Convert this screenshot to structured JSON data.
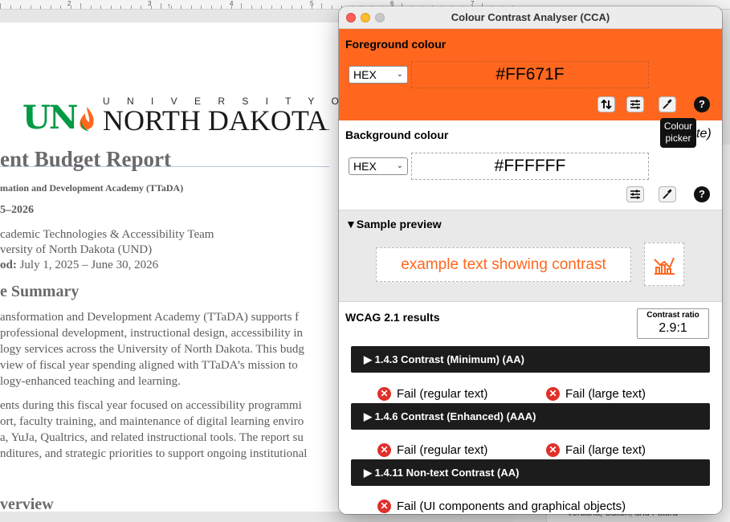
{
  "background_document": {
    "ruler": {
      "numbers": [
        "2",
        "3",
        "4",
        "5",
        "6",
        "7"
      ]
    },
    "logo": {
      "mark": "UND",
      "university_spaced": "U N I V E R S I T Y   O F",
      "name": "NORTH DAKOTA",
      "trademark": "."
    },
    "lines": [
      {
        "text": "ent Budget Report",
        "style": "h1"
      },
      {
        "text": "mation and Development Academy (TTaDA)",
        "style": "sub"
      },
      {
        "text": "5–2026",
        "style": "yr"
      },
      {
        "text": "cademic Technologies & Accessibility Team",
        "style": "p"
      },
      {
        "text": "versity of North Dakota (UND)",
        "style": "p"
      },
      {
        "text_bold": "od:",
        "text": " July 1, 2025 – June 30, 2026",
        "style": "p"
      },
      {
        "text": "e Summary",
        "style": "h2"
      },
      {
        "text": "ansformation and Development Academy (TTaDA) supports f",
        "style": "p"
      },
      {
        "text": " professional development, instructional design, accessibility in",
        "style": "p"
      },
      {
        "text": "logy services across the University of North Dakota. This budg",
        "style": "p"
      },
      {
        "text": "view of fiscal year spending aligned with TTaDA’s mission to",
        "style": "p"
      },
      {
        "text": "logy-enhanced teaching and learning.",
        "style": "p"
      },
      {
        "text": "ents during this fiscal year focused on accessibility programmi",
        "style": "p"
      },
      {
        "text": "ort, faculty training, and maintenance of digital learning enviro",
        "style": "p"
      },
      {
        "text": "a, YuJa, Qualtrics, and related instructional tools. The report su",
        "style": "p"
      },
      {
        "text": "nditures, and strategic priorities to support ongoing institutional",
        "style": "p"
      },
      {
        "text": "verview",
        "style": "h2"
      }
    ],
    "side_panel_text": "Verdana, Calibri, and Futura"
  },
  "cca": {
    "window_title": "Colour Contrast Analyser (CCA)",
    "foreground": {
      "label": "Foreground colour",
      "format": "HEX",
      "value": "#FF671F",
      "color": "#FF671F"
    },
    "background": {
      "label": "Background colour",
      "format": "HEX",
      "value": "#FFFFFF",
      "color": "#FFFFFF"
    },
    "tooltip": {
      "line1": "Colour",
      "line2": "picker",
      "behind_text": "te)"
    },
    "help_label": "?",
    "sample": {
      "label": "▼Sample preview",
      "text": "example text showing contrast"
    },
    "wcag": {
      "label": "WCAG 2.1 results",
      "ratio_label": "Contrast ratio",
      "ratio_value": "2.9:1",
      "criteria": [
        {
          "title": "▶ 1.4.3 Contrast (Minimum) (AA)",
          "results": [
            "Fail (regular text)",
            "Fail (large text)"
          ]
        },
        {
          "title": "▶ 1.4.6 Contrast (Enhanced) (AAA)",
          "results": [
            "Fail (regular text)",
            "Fail (large text)"
          ]
        },
        {
          "title": "▶ 1.4.11 Non-text Contrast (AA)",
          "results": [
            "Fail (UI components and graphical objects)"
          ]
        }
      ],
      "fail_glyph": "✕"
    },
    "colors": {
      "fail_red": "#E0302A",
      "criteria_bar": "#1C1C1C"
    }
  }
}
